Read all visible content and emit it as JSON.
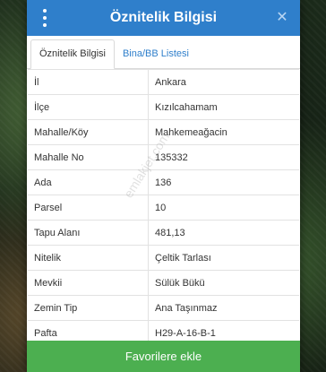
{
  "header": {
    "title": "Öznitelik Bilgisi",
    "menu_icon": "kebab-menu-icon",
    "close_label": "✕"
  },
  "tabs": [
    {
      "label": "Öznitelik Bilgisi",
      "active": true
    },
    {
      "label": "Bina/BB Listesi",
      "active": false
    }
  ],
  "attributes": [
    {
      "key": "İl",
      "value": "Ankara"
    },
    {
      "key": "İlçe",
      "value": "Kızılcahamam"
    },
    {
      "key": "Mahalle/Köy",
      "value": "Mahkemeağacin"
    },
    {
      "key": "Mahalle No",
      "value": "135332"
    },
    {
      "key": "Ada",
      "value": "136"
    },
    {
      "key": "Parsel",
      "value": "10"
    },
    {
      "key": "Tapu Alanı",
      "value": "481,13"
    },
    {
      "key": "Nitelik",
      "value": "Çeltik Tarlası"
    },
    {
      "key": "Mevkii",
      "value": "Sülük Bükü"
    },
    {
      "key": "Zemin Tip",
      "value": "Ana Taşınmaz"
    },
    {
      "key": "Pafta",
      "value": "H29-A-16-B-1"
    }
  ],
  "watermark": "emlakjet.com",
  "footer": {
    "add_button_label": "Favorilere ekle"
  },
  "colors": {
    "header_bg": "#2f7fcb",
    "button_bg": "#4caf50",
    "tab_link": "#2f7fcb"
  }
}
